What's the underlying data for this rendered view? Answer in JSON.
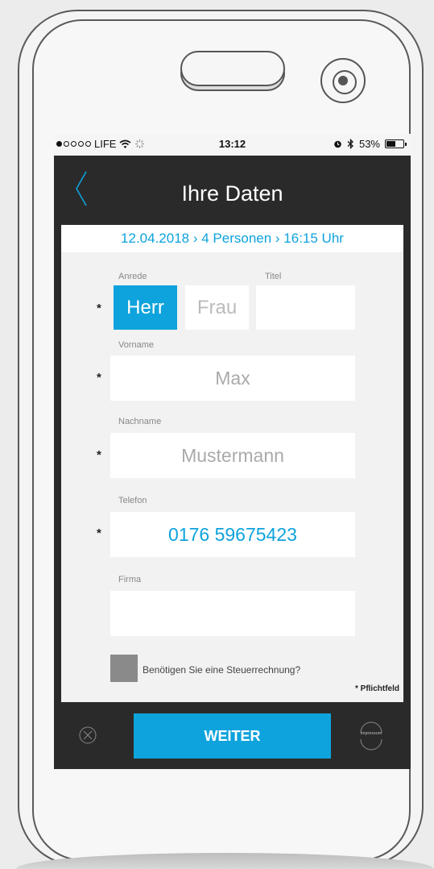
{
  "status": {
    "carrier": "LIFE",
    "time": "13:12",
    "battery": "53%",
    "battery_level": 0.53
  },
  "nav": {
    "title": "Ihre Daten",
    "back_icon": "chevron-left-icon"
  },
  "summary": "12.04.2018 › 4 Personen › 16:15 Uhr",
  "form": {
    "anrede_label": "Anrede",
    "titel_label": "Titel",
    "anrede_options": [
      "Herr",
      "Frau"
    ],
    "anrede_selected": "Herr",
    "titel_value": "",
    "vorname_label": "Vorname",
    "vorname_placeholder": "Max",
    "nachname_label": "Nachname",
    "nachname_placeholder": "Mustermann",
    "telefon_label": "Telefon",
    "telefon_value": "0176 59675423",
    "firma_label": "Firma",
    "firma_value": "",
    "required_marker": "*",
    "tax_invoice_label": "Benötigen Sie eine Steuerrechnung?",
    "required_note": "* Pflichtfeld"
  },
  "bottom": {
    "weiter_label": "WEITER",
    "impressum_label": "Impressum"
  },
  "colors": {
    "accent": "#0ea3dc",
    "bar": "#2b2a2a"
  }
}
